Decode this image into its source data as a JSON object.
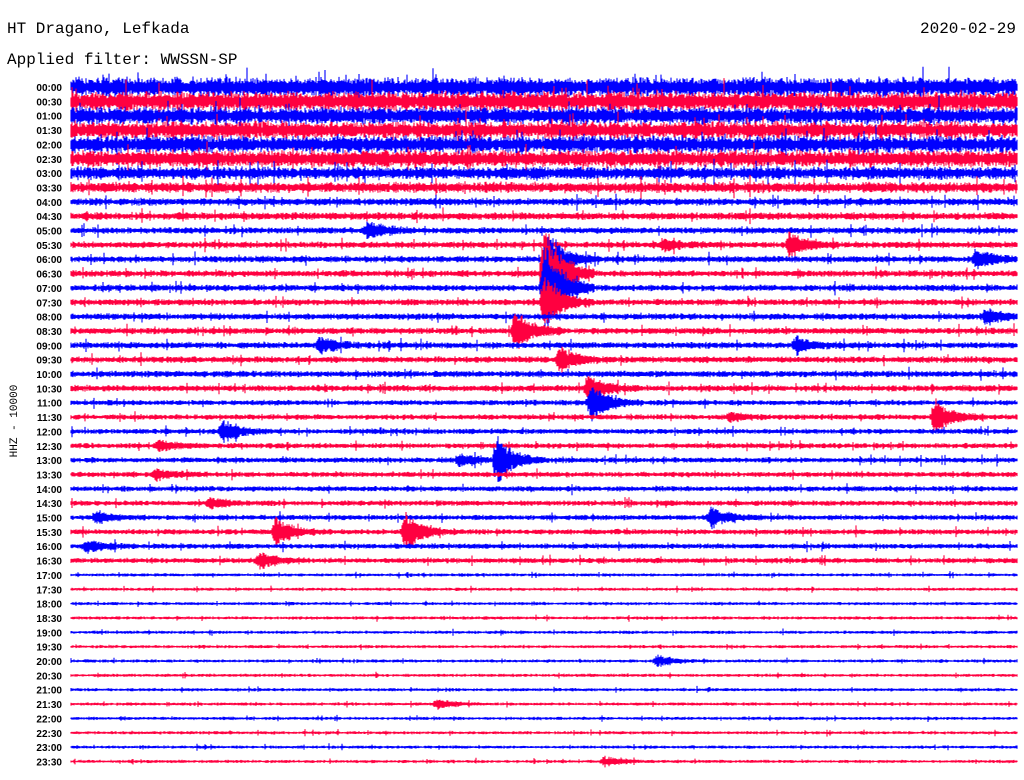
{
  "header": {
    "station": "HT Dragano, Lefkada",
    "date": "2020-02-29",
    "filter": "Applied filter: WWSSN-SP"
  },
  "chart_data": {
    "type": "line",
    "title": "HT Dragano, Lefkada",
    "ylabel": "HHZ - 10000",
    "row_minutes": 30,
    "colors": {
      "even": "#0000ff",
      "odd": "#ff0040"
    },
    "row_labels": [
      "00:00",
      "00:30",
      "01:00",
      "01:30",
      "02:00",
      "02:30",
      "03:00",
      "03:30",
      "04:00",
      "04:30",
      "05:00",
      "05:30",
      "06:00",
      "06:30",
      "07:00",
      "07:30",
      "08:00",
      "08:30",
      "09:00",
      "09:30",
      "10:00",
      "10:30",
      "11:00",
      "11:30",
      "12:00",
      "12:30",
      "13:00",
      "13:30",
      "14:00",
      "14:30",
      "15:00",
      "15:30",
      "16:00",
      "16:30",
      "17:00",
      "17:30",
      "18:00",
      "18:30",
      "19:00",
      "19:30",
      "20:00",
      "20:30",
      "21:00",
      "21:30",
      "22:00",
      "22:30",
      "23:00",
      "23:30"
    ],
    "noise_level": [
      9,
      9,
      8,
      8,
      8,
      8,
      6,
      5,
      3.5,
      3.5,
      3,
      3,
      3,
      3,
      3,
      3,
      3,
      3,
      3,
      3,
      3,
      3,
      2.5,
      2.5,
      2.5,
      2.5,
      2.5,
      2.5,
      2.5,
      2.5,
      2.5,
      2.5,
      2.5,
      2.5,
      1.5,
      1.5,
      1.5,
      1.5,
      1.5,
      1.5,
      1.5,
      1.5,
      1.5,
      1.5,
      1.5,
      1.5,
      1.5,
      1.5
    ],
    "events": [
      {
        "row": 10,
        "minute": 9.4,
        "amp": 9
      },
      {
        "row": 11,
        "minute": 18.8,
        "amp": 6
      },
      {
        "row": 11,
        "minute": 22.8,
        "amp": 12
      },
      {
        "row": 12,
        "minute": 28.7,
        "amp": 10
      },
      {
        "row": 12,
        "minute": 15.1,
        "amp": 30
      },
      {
        "row": 13,
        "minute": 15.0,
        "amp": 60
      },
      {
        "row": 14,
        "minute": 15.0,
        "amp": 55
      },
      {
        "row": 15,
        "minute": 15.0,
        "amp": 30
      },
      {
        "row": 16,
        "minute": 29.0,
        "amp": 8
      },
      {
        "row": 17,
        "minute": 14.1,
        "amp": 20
      },
      {
        "row": 18,
        "minute": 7.9,
        "amp": 8
      },
      {
        "row": 18,
        "minute": 23.0,
        "amp": 8
      },
      {
        "row": 19,
        "minute": 15.5,
        "amp": 12
      },
      {
        "row": 21,
        "minute": 16.4,
        "amp": 14
      },
      {
        "row": 22,
        "minute": 16.5,
        "amp": 20
      },
      {
        "row": 23,
        "minute": 27.4,
        "amp": 18
      },
      {
        "row": 23,
        "minute": 20.9,
        "amp": 5
      },
      {
        "row": 24,
        "minute": 4.8,
        "amp": 12
      },
      {
        "row": 25,
        "minute": 2.8,
        "amp": 5
      },
      {
        "row": 26,
        "minute": 12.3,
        "amp": 6
      },
      {
        "row": 26,
        "minute": 13.5,
        "amp": 25
      },
      {
        "row": 27,
        "minute": 2.7,
        "amp": 5
      },
      {
        "row": 29,
        "minute": 4.4,
        "amp": 5
      },
      {
        "row": 30,
        "minute": 0.8,
        "amp": 6
      },
      {
        "row": 30,
        "minute": 20.3,
        "amp": 10
      },
      {
        "row": 31,
        "minute": 6.5,
        "amp": 15
      },
      {
        "row": 31,
        "minute": 10.6,
        "amp": 22
      },
      {
        "row": 32,
        "minute": 0.5,
        "amp": 6
      },
      {
        "row": 33,
        "minute": 6.0,
        "amp": 8
      },
      {
        "row": 40,
        "minute": 18.6,
        "amp": 6
      },
      {
        "row": 43,
        "minute": 11.6,
        "amp": 5
      },
      {
        "row": 47,
        "minute": 16.9,
        "amp": 5
      }
    ]
  }
}
